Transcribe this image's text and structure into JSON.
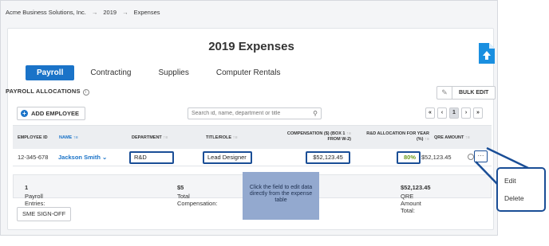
{
  "breadcrumb": {
    "items": [
      "Acme Business Solutions, Inc.",
      "2019",
      "Expenses"
    ],
    "separator": "→"
  },
  "page": {
    "title": "2019 Expenses"
  },
  "tabs": [
    {
      "label": "Payroll",
      "active": true
    },
    {
      "label": "Contracting",
      "active": false
    },
    {
      "label": "Supplies",
      "active": false
    },
    {
      "label": "Computer Rentals",
      "active": false
    }
  ],
  "section": {
    "title": "PAYROLL ALLOCATIONS",
    "info_icon": "ⓘ",
    "bulk_edit": "BULK EDIT",
    "add_employee": "ADD EMPLOYEE"
  },
  "search": {
    "placeholder": "Search id, name, department or title"
  },
  "pager": {
    "first": "«",
    "prev": "‹",
    "current": "1",
    "next": "›",
    "last": "»"
  },
  "table": {
    "headers": {
      "employee_id": "EMPLOYEE ID",
      "name": "NAME",
      "department": "DEPARTMENT",
      "title_role": "TITLE/ROLE",
      "compensation_line1": "COMPENSATION ($) (BOX 1",
      "compensation_line2": "FROM W-2)",
      "rd_line1": "R&D ALLOCATION FOR YEAR",
      "rd_line2": "(%)",
      "qre_amount": "QRE AMOUNT"
    },
    "rows": [
      {
        "employee_id": "12-345-678",
        "name": "Jackson Smith",
        "department": "R&D",
        "title_role": "Lead Designer",
        "compensation": "$52,123.45",
        "rd_allocation": "80%",
        "qre_amount": "$52,123.45"
      }
    ]
  },
  "summary": {
    "payroll_entries_label": "Payroll Entries:",
    "payroll_entries_value": "1",
    "total_comp_label": "Total Compensation:",
    "total_comp_value": "$5",
    "qre_total_label": "QRE Amount Total:",
    "qre_total_value": "$52,123.45"
  },
  "sme_signoff": "SME SIGN-OFF",
  "tooltip": "Click the field to edit data directly from the expense table",
  "row_menu": {
    "more": "···",
    "items": [
      "Edit",
      "Delete"
    ]
  },
  "colors": {
    "accent": "#1a73c8",
    "highlight": "#1a4e96",
    "tooltip_bg": "#93a9cf",
    "rd_green": "#6b9a1c"
  }
}
